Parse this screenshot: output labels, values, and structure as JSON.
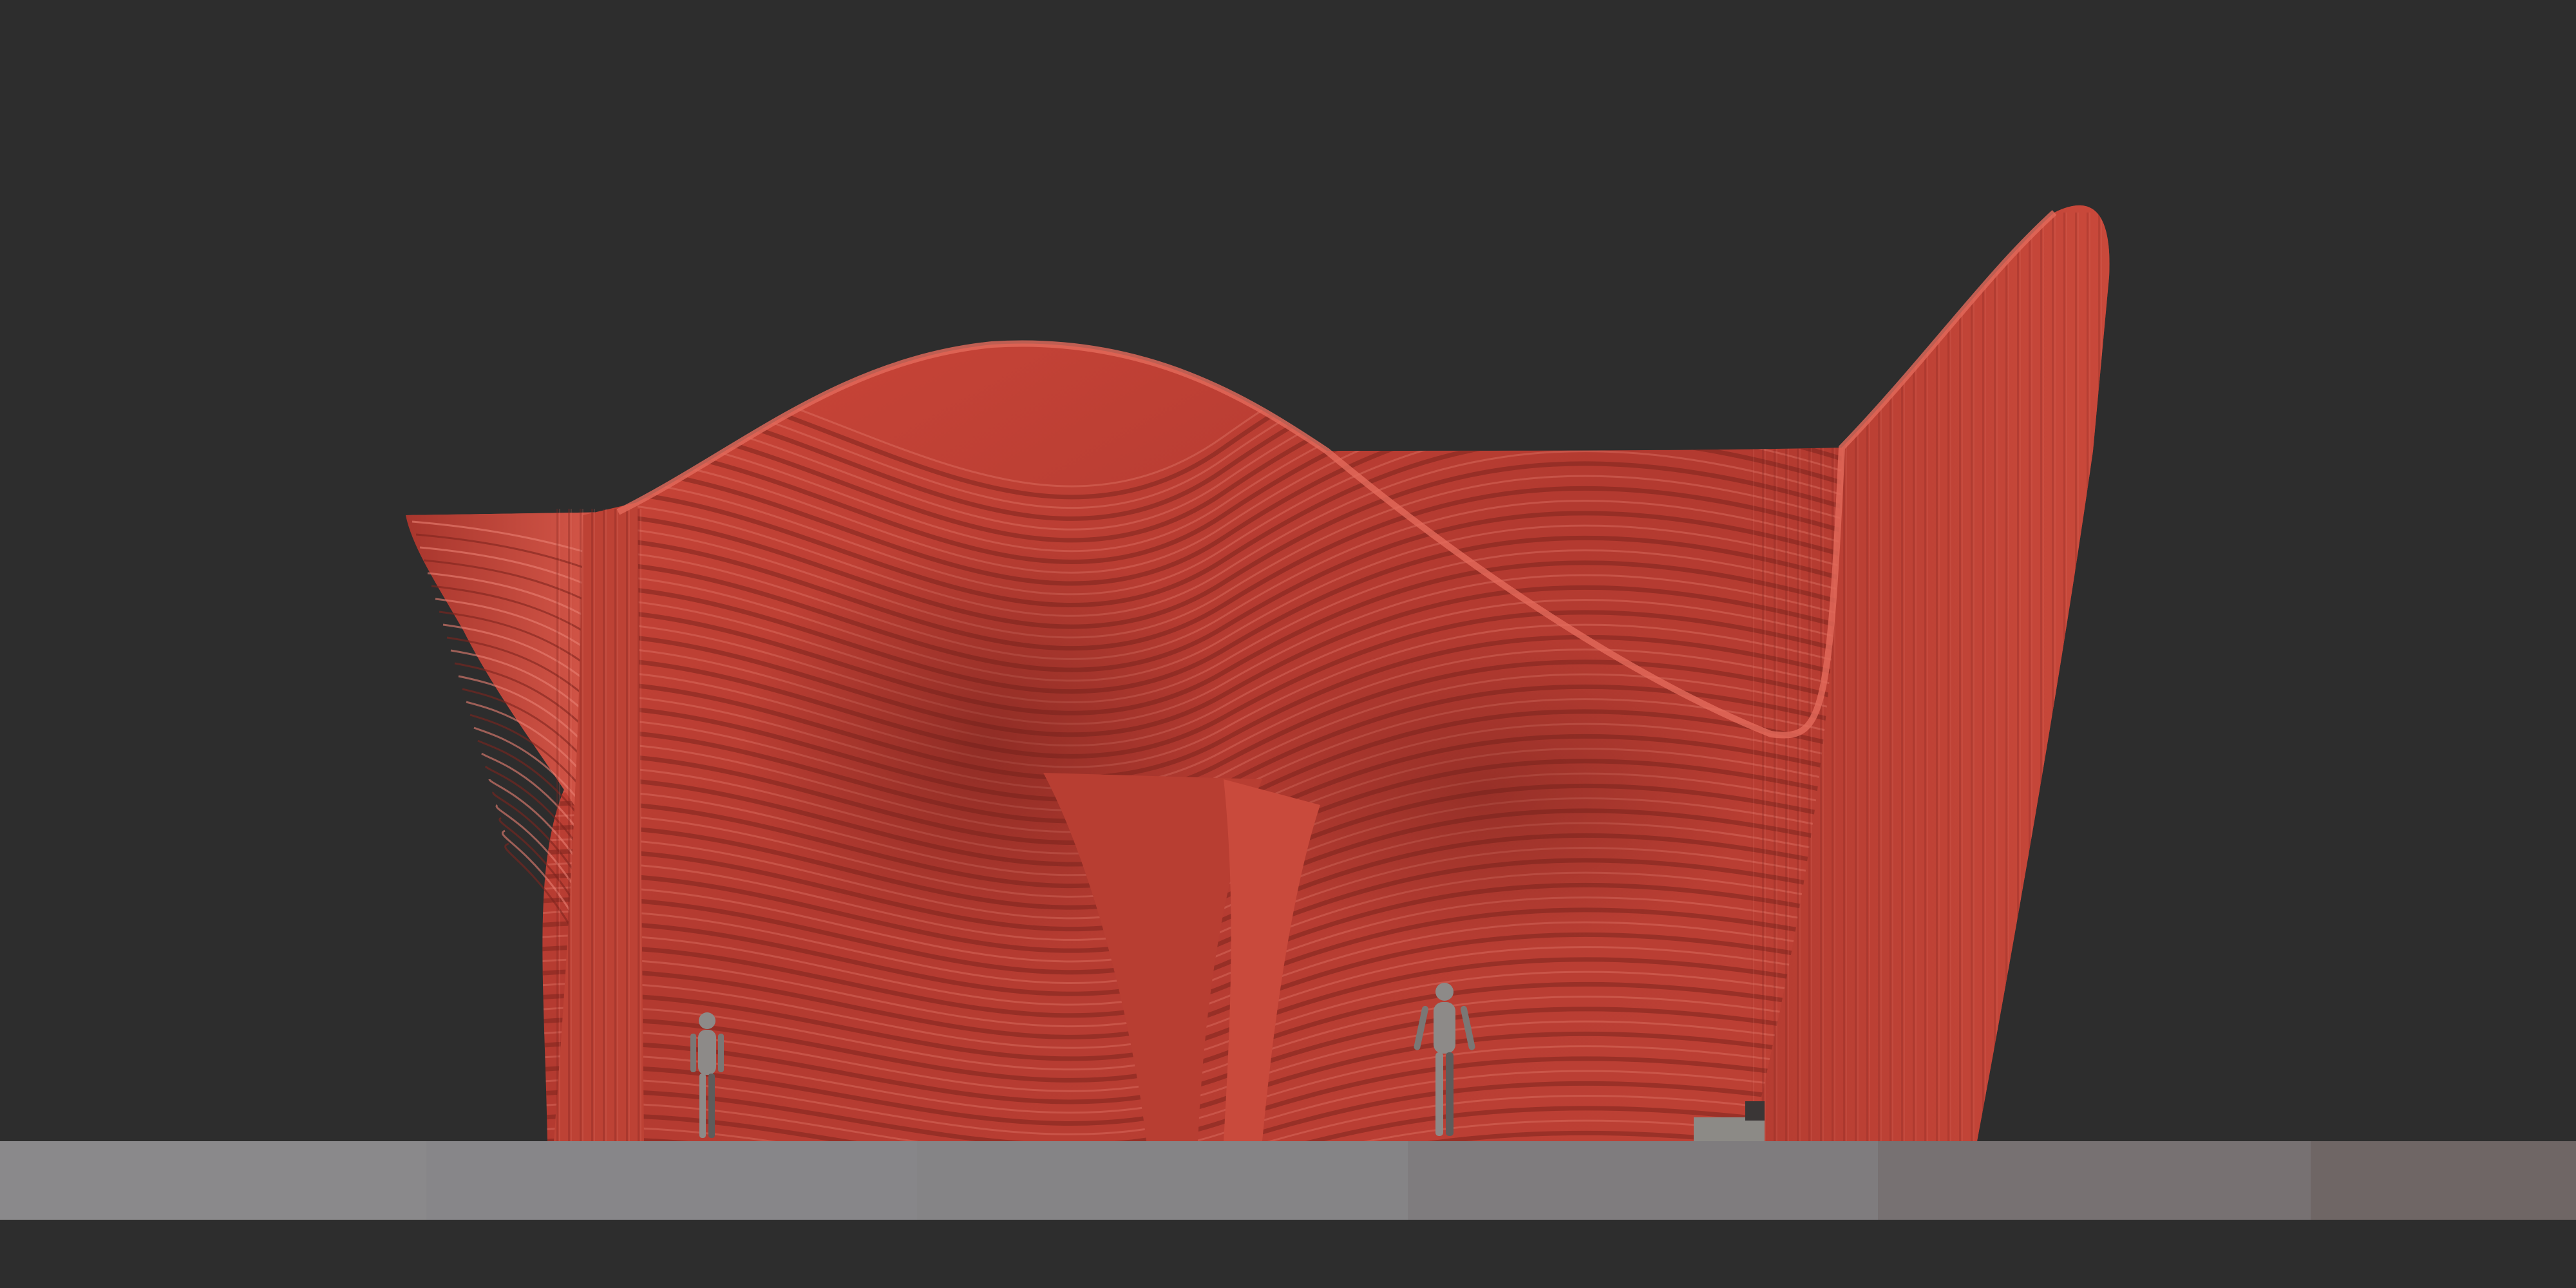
{
  "scene": {
    "subject": "parametric-ribbed-pavilion",
    "colors": {
      "background": "#2d2d2d",
      "sculpture_light": "#d0483a",
      "sculpture_mid": "#b23a30",
      "sculpture_dark": "#7e241e",
      "rib_highlight": "#e98173",
      "figure": "#8d8a88",
      "figure_shadow": "#5e5c5b"
    },
    "ground_strip_colors": [
      "#8a898b",
      "#878689",
      "#858486",
      "#7f7c7e",
      "#777172",
      "#6f6665"
    ],
    "figures": [
      "mannequin-left",
      "mannequin-center",
      "mannequin-right-partial"
    ]
  }
}
